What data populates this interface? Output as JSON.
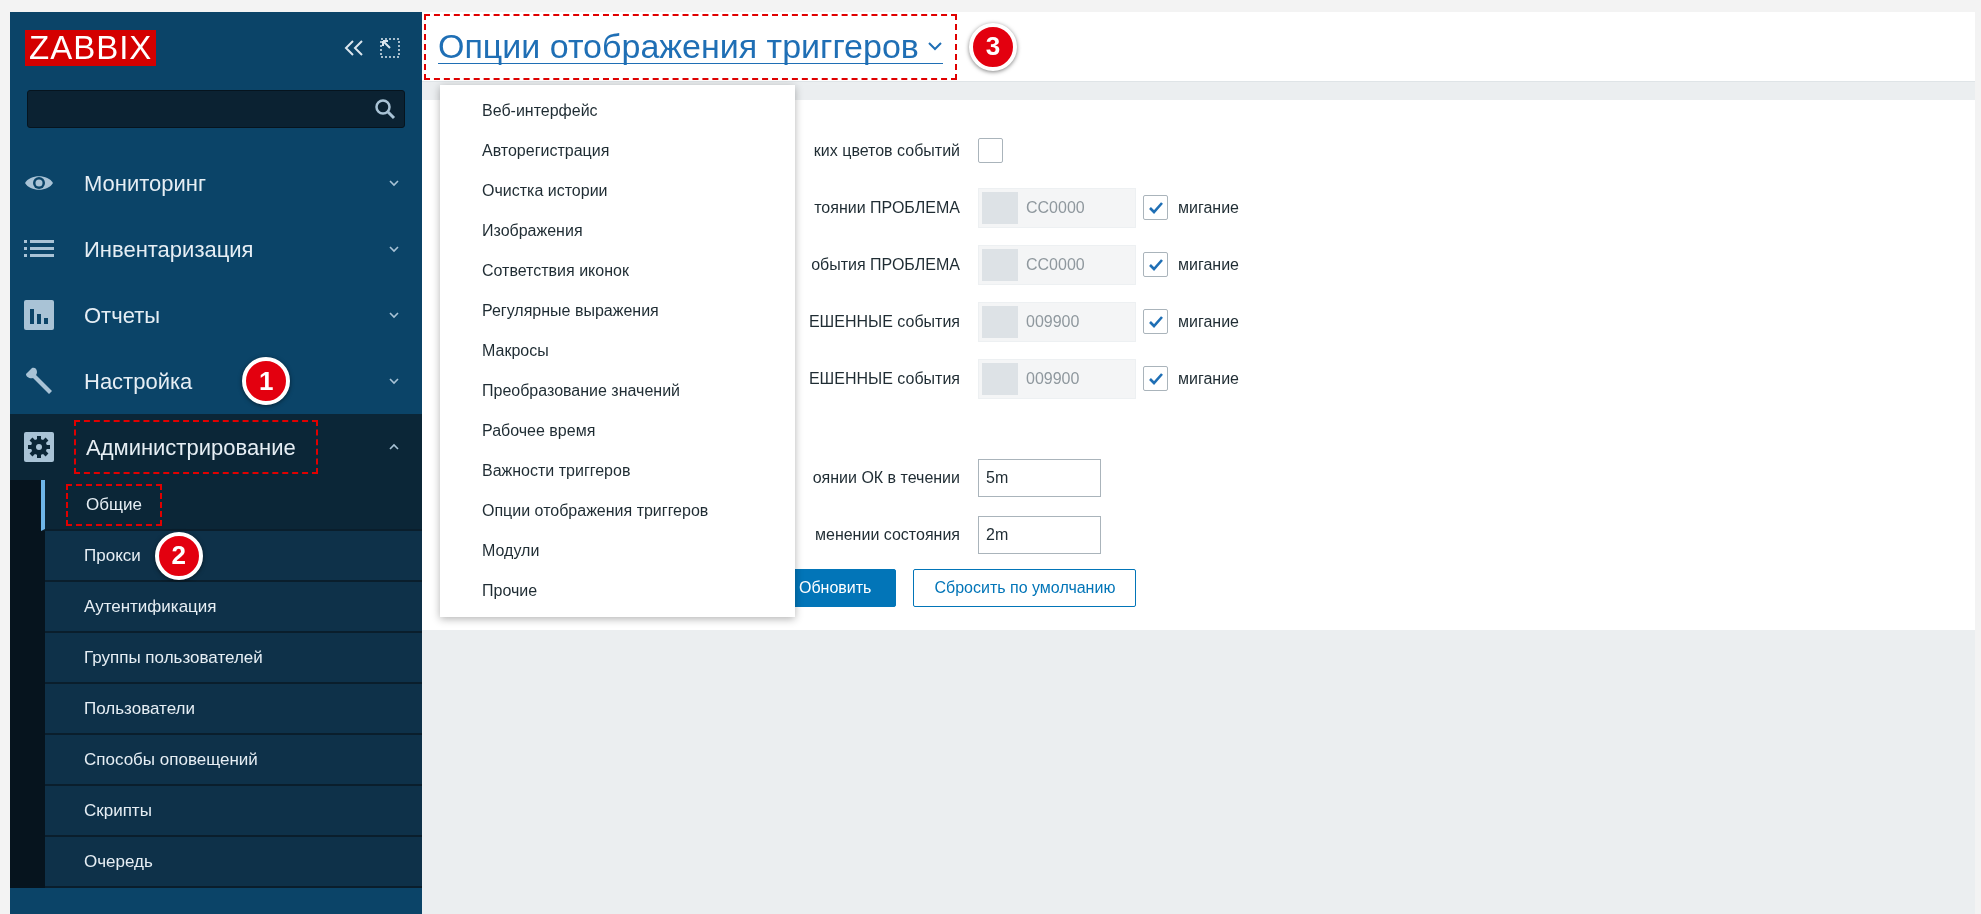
{
  "sidebar": {
    "logo": "ZABBIX",
    "menu": [
      {
        "label": "Мониторинг",
        "expanded": false
      },
      {
        "label": "Инвентаризация",
        "expanded": false
      },
      {
        "label": "Отчеты",
        "expanded": false
      },
      {
        "label": "Настройка",
        "expanded": false,
        "badge": "1"
      },
      {
        "label": "Администрирование",
        "expanded": true,
        "highlighted": true,
        "children": [
          {
            "label": "Общие",
            "selected": true,
            "highlighted": true
          },
          {
            "label": "Прокси",
            "selected": false,
            "badge": "2"
          },
          {
            "label": "Аутентификация",
            "selected": false
          },
          {
            "label": "Группы пользователей",
            "selected": false
          },
          {
            "label": "Пользователи",
            "selected": false
          },
          {
            "label": "Способы оповещений",
            "selected": false
          },
          {
            "label": "Скрипты",
            "selected": false
          },
          {
            "label": "Очередь",
            "selected": false
          }
        ]
      }
    ]
  },
  "header": {
    "title": "Опции отображения триггеров",
    "highlighted": true,
    "badge": "3"
  },
  "dropdown": [
    "Веб-интерфейс",
    "Авторегистрация",
    "Очистка истории",
    "Изображения",
    "Сответствия иконок",
    "Регулярные выражения",
    "Макросы",
    "Преобразование значений",
    "Рабочее время",
    "Важности триггеров",
    "Опции отображения триггеров",
    "Модули",
    "Прочие"
  ],
  "form": {
    "rows": [
      {
        "kind": "checkbox",
        "label": "ких цветов событий",
        "checked": false
      },
      {
        "kind": "color",
        "label": "тоянии ПРОБЛЕМА",
        "value": "CC0000",
        "disabled": true,
        "blink_label": "мигание",
        "blink": true
      },
      {
        "kind": "color",
        "label": "обытия ПРОБЛЕМА",
        "value": "CC0000",
        "disabled": true,
        "blink_label": "мигание",
        "blink": true
      },
      {
        "kind": "color",
        "label": "ЕШЕННЫЕ события",
        "value": "009900",
        "disabled": true,
        "blink_label": "мигание",
        "blink": true
      },
      {
        "kind": "color",
        "label": "ЕШЕННЫЕ события",
        "value": "009900",
        "disabled": true,
        "blink_label": "мигание",
        "blink": true
      },
      {
        "kind": "text",
        "label": "оянии ОК в течении",
        "value": "5m"
      },
      {
        "kind": "text",
        "label": "менении состояния",
        "value": "2m"
      }
    ],
    "buttons": [
      {
        "label": "Обновить",
        "kind": "primary"
      },
      {
        "label": "Сбросить по умолчанию",
        "kind": "secondary"
      }
    ]
  }
}
